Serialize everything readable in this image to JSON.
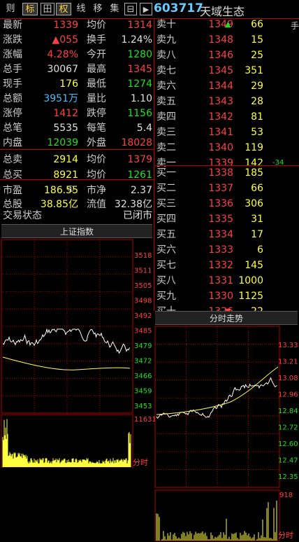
{
  "toolbar": {
    "buttons": [
      "则",
      "标",
      "田",
      "权",
      "线",
      "移",
      "集",
      "⊟",
      "▶"
    ],
    "code": "603717",
    "name": "天域生态",
    "right_label": "手"
  },
  "info": {
    "rows": [
      {
        "l1": "最新",
        "v1": "1339",
        "l2": "均价",
        "v2": "1314"
      },
      {
        "l1": "涨跌",
        "v1": "▲055",
        "l2": "换手",
        "v2": "1.24%"
      },
      {
        "l1": "涨幅",
        "v1": "4.28%",
        "l2": "今开",
        "v2": "1280"
      },
      {
        "l1": "总手",
        "v1": "30067",
        "l2": "最高",
        "v2": "1345"
      },
      {
        "l1": "现手",
        "v1": "176",
        "l2": "最低",
        "v2": "1274"
      },
      {
        "l1": "总额",
        "v1": "3951万",
        "l2": "量比",
        "v2": "1.10"
      },
      {
        "l1": "涨停",
        "v1": "1412",
        "l2": "跌停",
        "v2": "1156"
      },
      {
        "l1": "总笔",
        "v1": "5535",
        "l2": "每笔",
        "v2": "5.4"
      },
      {
        "l1": "内盘",
        "v1": "12039",
        "l2": "外盘",
        "v2": "18028"
      },
      {
        "l1": "总卖",
        "v1": "2914",
        "l2": "均价",
        "v2": "1379"
      },
      {
        "l1": "总买",
        "v1": "8921",
        "l2": "均价",
        "v2": "1261"
      },
      {
        "l1": "市盈",
        "v1": "186.55",
        "l2": "市净",
        "v2": "2.37"
      },
      {
        "l1": "总股",
        "v1": "38.85亿",
        "l2": "流值",
        "v2": "32.38亿"
      }
    ],
    "badge": "①",
    "status_label": "交易状态",
    "status_value": "已闭市"
  },
  "orderbook": {
    "sells": [
      {
        "label": "卖十",
        "price": "1349",
        "vol": "66",
        "arrow": "▲"
      },
      {
        "label": "卖九",
        "price": "1348",
        "vol": "15"
      },
      {
        "label": "卖八",
        "price": "1346",
        "vol": "25"
      },
      {
        "label": "卖七",
        "price": "1345",
        "vol": "351"
      },
      {
        "label": "卖六",
        "price": "1344",
        "vol": "29"
      },
      {
        "label": "卖五",
        "price": "1343",
        "vol": "28"
      },
      {
        "label": "卖四",
        "price": "1342",
        "vol": "81"
      },
      {
        "label": "卖三",
        "price": "1341",
        "vol": "53"
      },
      {
        "label": "卖二",
        "price": "1340",
        "vol": "119"
      },
      {
        "label": "卖一",
        "price": "1339",
        "vol": "142",
        "chg": "-34"
      }
    ],
    "buys": [
      {
        "label": "买一",
        "price": "1338",
        "vol": "185"
      },
      {
        "label": "买二",
        "price": "1337",
        "vol": "66"
      },
      {
        "label": "买三",
        "price": "1336",
        "vol": "306"
      },
      {
        "label": "买四",
        "price": "1335",
        "vol": "31"
      },
      {
        "label": "买五",
        "price": "1334",
        "vol": "17"
      },
      {
        "label": "买六",
        "price": "1333",
        "vol": "6"
      },
      {
        "label": "买七",
        "price": "1332",
        "vol": "145"
      },
      {
        "label": "买八",
        "price": "1331",
        "vol": "1000"
      },
      {
        "label": "买九",
        "price": "1330",
        "vol": "1125"
      },
      {
        "label": "买十",
        "price": "1326",
        "vol": "22",
        "arrow": "▼"
      }
    ]
  },
  "index_chart": {
    "title": "上证指数",
    "ticks": [
      "3518",
      "3511",
      "3505",
      "3498",
      "3492",
      "3485",
      "3479",
      "3472",
      "3466",
      "3459",
      "3453"
    ],
    "vol_max": "11631",
    "xlabel": "分时"
  },
  "intraday_chart": {
    "title": "分时走势",
    "ticks": [
      "13.33",
      "13.21",
      "13.08",
      "12.96",
      "12.84",
      "12.72",
      "12.60",
      "12.47",
      "12.35"
    ],
    "vol_max": "918",
    "xlabel": "分时"
  },
  "colors": {
    "up": "#ff4040",
    "down": "#20e020",
    "grid": "#b00000",
    "price": "#ffffff",
    "avg": "#ffff40"
  }
}
